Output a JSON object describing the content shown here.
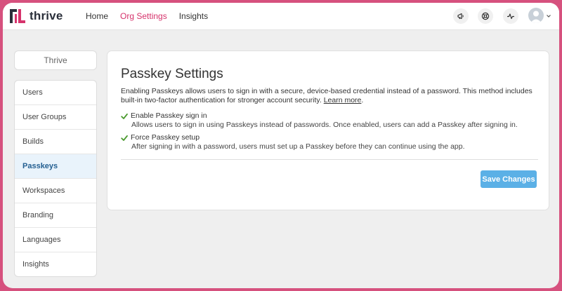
{
  "brand": {
    "name": "thrive"
  },
  "nav": {
    "items": [
      {
        "label": "Home",
        "active": false
      },
      {
        "label": "Org Settings",
        "active": true
      },
      {
        "label": "Insights",
        "active": false
      }
    ]
  },
  "header_icons": [
    "megaphone-icon",
    "support-icon",
    "activity-icon",
    "avatar",
    "chevron-down-icon"
  ],
  "sidebar": {
    "org_name": "Thrive",
    "items": [
      {
        "label": "Users",
        "active": false
      },
      {
        "label": "User Groups",
        "active": false
      },
      {
        "label": "Builds",
        "active": false
      },
      {
        "label": "Passkeys",
        "active": true
      },
      {
        "label": "Workspaces",
        "active": false
      },
      {
        "label": "Branding",
        "active": false
      },
      {
        "label": "Languages",
        "active": false
      },
      {
        "label": "Insights",
        "active": false
      }
    ]
  },
  "main": {
    "title": "Passkey Settings",
    "description": "Enabling Passkeys allows users to sign in with a secure, device-based credential instead of a password. This method includes built-in two-factor authentication for stronger account security.",
    "learn_more": "Learn more",
    "options": [
      {
        "label": "Enable Passkey sign in",
        "checked": true,
        "help": "Allows users to sign in using Passkeys instead of passwords. Once enabled, users can add a Passkey after signing in."
      },
      {
        "label": "Force Passkey setup",
        "checked": true,
        "help": "After signing in with a password, users must set up a Passkey before they can continue using the app."
      }
    ],
    "save_label": "Save Changes"
  },
  "colors": {
    "accent": "#d6336c",
    "button": "#5bb0e6",
    "sidebar_active_bg": "#e9f3fb",
    "sidebar_active_text": "#245f91",
    "check": "#4a9a2e"
  }
}
